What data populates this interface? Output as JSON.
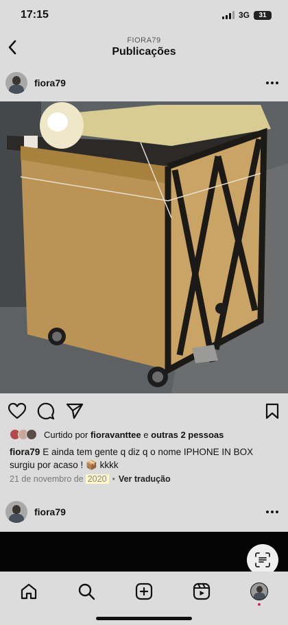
{
  "status": {
    "time": "17:15",
    "network": "3G",
    "battery": "31"
  },
  "header": {
    "account": "FIORA79",
    "title": "Publicações"
  },
  "post": {
    "username": "fiora79",
    "likes": {
      "prefix": "Curtido por",
      "user": "fioravanttee",
      "conj": "e",
      "others": "outras 2 pessoas"
    },
    "caption": {
      "username": "fiora79",
      "text": "E ainda tem gente q diz q o nome IPHONE IN BOX surgiu por acaso ! 📦 kkkk"
    },
    "date_prefix": "21 de novembro de",
    "date_year": "2020",
    "separator": "•",
    "translate_label": "Ver tradução"
  },
  "next_post": {
    "username": "fiora79"
  },
  "icons": {
    "back": "chevron-left-icon",
    "more": "more-horizontal-icon",
    "like": "heart-icon",
    "comment": "comment-icon",
    "share": "send-icon",
    "save": "bookmark-icon",
    "lens": "scan-text-icon",
    "home": "home-icon",
    "search": "search-icon",
    "create": "plus-square-icon",
    "reels": "reels-icon"
  },
  "colors": {
    "background": "#dcdcdc",
    "year_highlight": "#fff6c9",
    "notification": "#e0245e"
  }
}
